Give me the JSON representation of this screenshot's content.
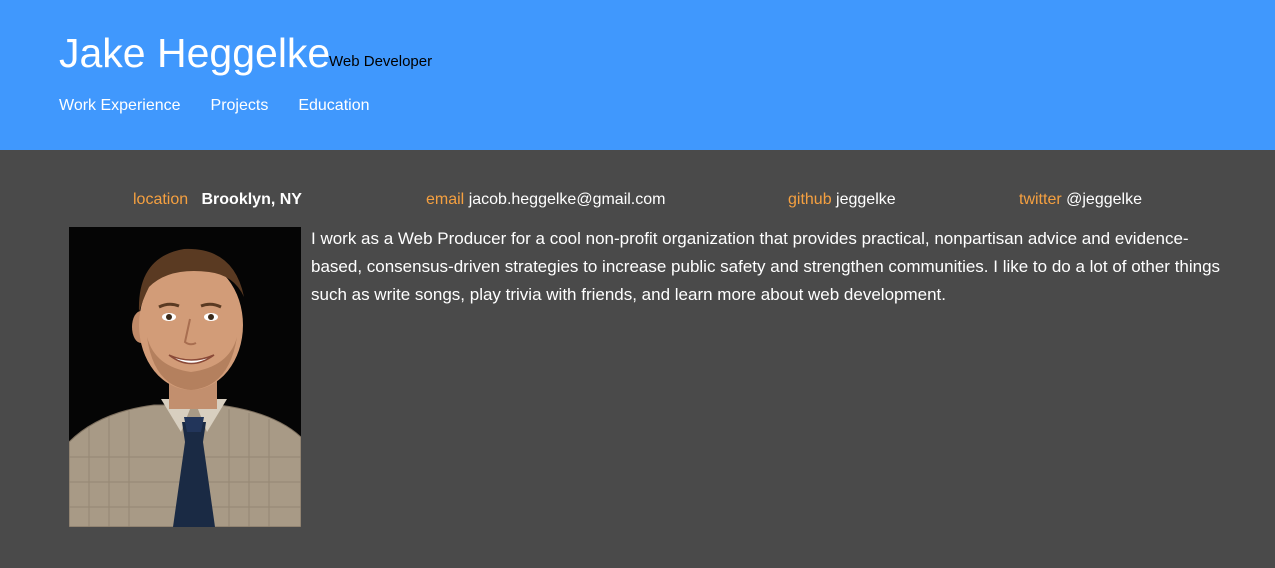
{
  "header": {
    "name": "Jake Heggelke",
    "role": "Web Developer",
    "nav": [
      "Work Experience",
      "Projects",
      "Education"
    ]
  },
  "contacts": {
    "location": {
      "label": "location",
      "value": "Brooklyn, NY"
    },
    "email": {
      "label": "email",
      "value": "jacob.heggelke@gmail.com"
    },
    "github": {
      "label": "github",
      "value": "jeggelke"
    },
    "twitter": {
      "label": "twitter",
      "value": "@jeggelke"
    }
  },
  "bio": " I work as a Web Producer for a cool non-profit organization that provides practical, nonpartisan advice and evidence-based, consensus-driven strategies to increase public safety and strengthen communities. I like to do a lot of other things such as write songs, play trivia with friends, and learn more about web development.",
  "colors": {
    "header_bg": "#4098fd",
    "body_bg": "#4a4a4a",
    "label_accent": "#f5a040"
  }
}
